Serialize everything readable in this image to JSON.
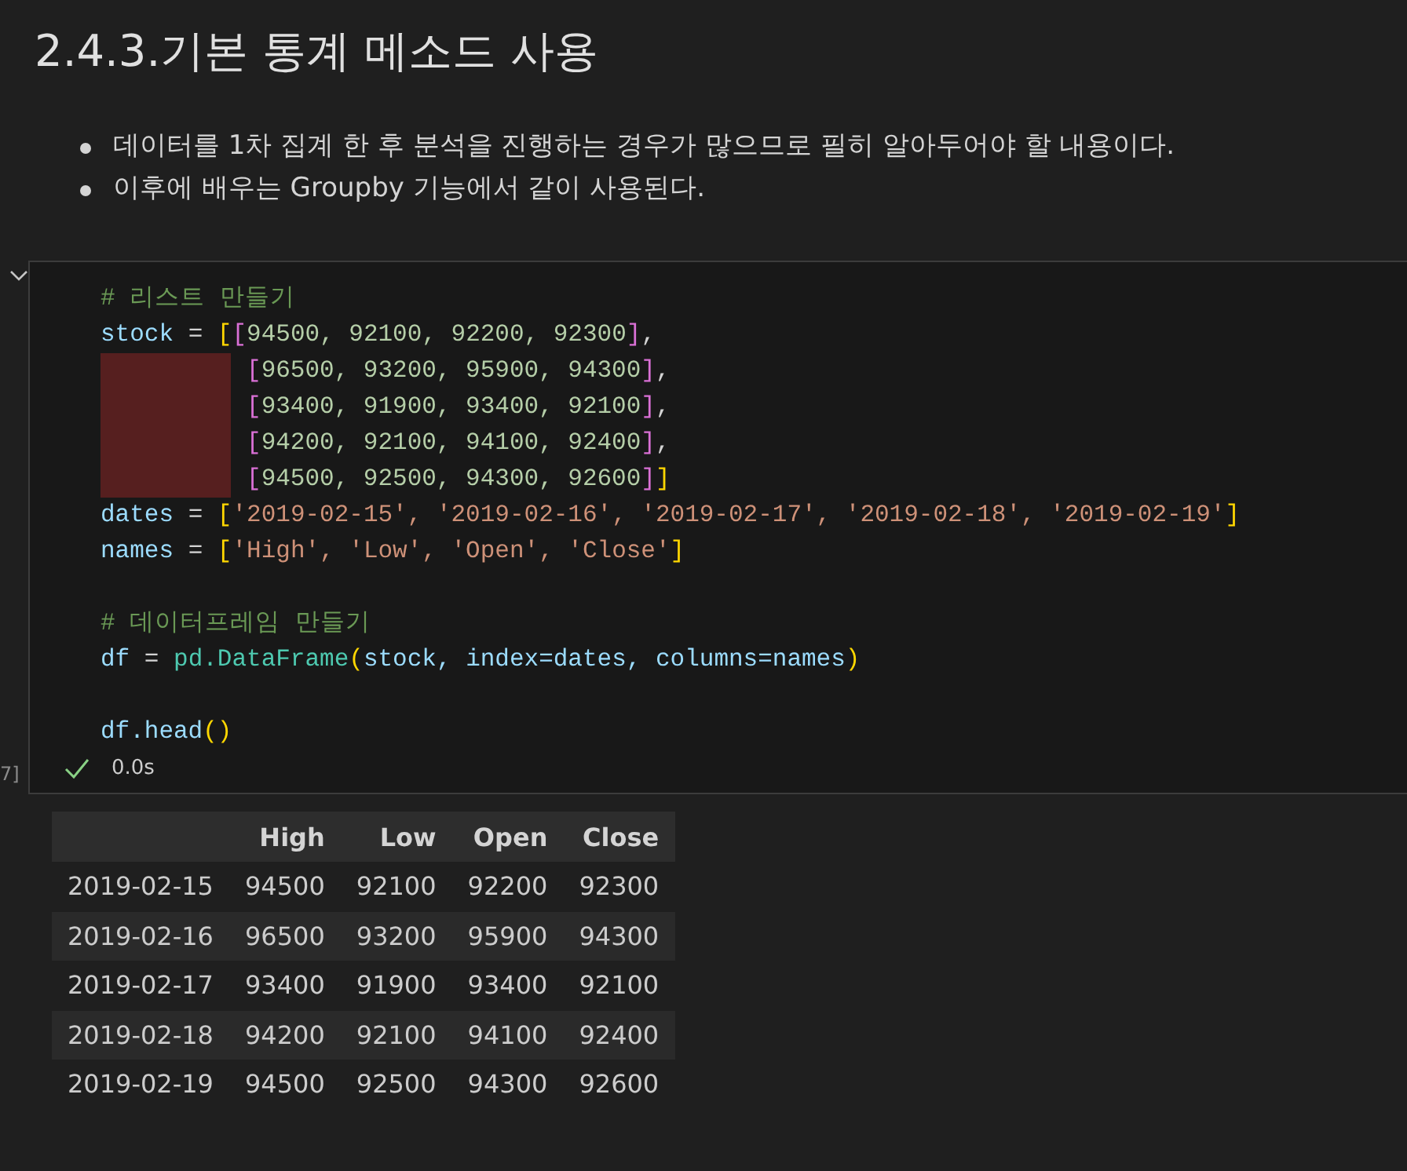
{
  "heading": "2.4.3.기본 통계 메소드 사용",
  "bullets": [
    "데이터를 1차 집계 한 후 분석을 진행하는 경우가 많으므로 필히 알아두어야 할 내용이다.",
    "이후에 배우는 Groupby 기능에서 같이 사용된다."
  ],
  "cell": {
    "expanded": true,
    "execution_count": "7]",
    "status": "0.0s",
    "code": [
      {
        "kind": "code",
        "tokens": [
          {
            "text": "# 리스트 만들기",
            "kind": "comment"
          }
        ]
      },
      {
        "kind": "code",
        "tokens": [
          {
            "text": "stock",
            "kind": "var"
          },
          {
            "text": " = ",
            "kind": "op"
          },
          {
            "text": "[",
            "kind": "b1"
          },
          {
            "text": "[",
            "kind": "b2"
          },
          {
            "text": "94500, 92100, 92200, 92300",
            "kind": "num"
          },
          {
            "text": "]",
            "kind": "b2"
          },
          {
            "text": ",",
            "kind": "op"
          }
        ]
      },
      {
        "kind": "code",
        "bad_indent": true,
        "tokens": [
          {
            "text": "[",
            "kind": "b2"
          },
          {
            "text": "96500, 93200, 95900, 94300",
            "kind": "num"
          },
          {
            "text": "]",
            "kind": "b2"
          },
          {
            "text": ",",
            "kind": "op"
          }
        ]
      },
      {
        "kind": "code",
        "bad_indent": true,
        "tokens": [
          {
            "text": "[",
            "kind": "b2"
          },
          {
            "text": "93400, 91900, 93400, 92100",
            "kind": "num"
          },
          {
            "text": "]",
            "kind": "b2"
          },
          {
            "text": ",",
            "kind": "op"
          }
        ]
      },
      {
        "kind": "code",
        "bad_indent": true,
        "tokens": [
          {
            "text": "[",
            "kind": "b2"
          },
          {
            "text": "94200, 92100, 94100, 92400",
            "kind": "num"
          },
          {
            "text": "]",
            "kind": "b2"
          },
          {
            "text": ",",
            "kind": "op"
          }
        ]
      },
      {
        "kind": "code",
        "bad_indent": true,
        "tokens": [
          {
            "text": "[",
            "kind": "b2"
          },
          {
            "text": "94500, 92500, 94300, 92600",
            "kind": "num"
          },
          {
            "text": "]",
            "kind": "b2"
          },
          {
            "text": "]",
            "kind": "b1"
          }
        ]
      },
      {
        "kind": "code",
        "tokens": [
          {
            "text": "dates",
            "kind": "var"
          },
          {
            "text": " = ",
            "kind": "op"
          },
          {
            "text": "[",
            "kind": "b1"
          },
          {
            "text": "'2019-02-15', '2019-02-16', '2019-02-17', '2019-02-18', '2019-02-19'",
            "kind": "str"
          },
          {
            "text": "]",
            "kind": "b1"
          }
        ]
      },
      {
        "kind": "code",
        "tokens": [
          {
            "text": "names",
            "kind": "var"
          },
          {
            "text": " = ",
            "kind": "op"
          },
          {
            "text": "[",
            "kind": "b1"
          },
          {
            "text": "'High', 'Low', 'Open', 'Close'",
            "kind": "str"
          },
          {
            "text": "]",
            "kind": "b1"
          }
        ]
      },
      {
        "kind": "blank"
      },
      {
        "kind": "code",
        "tokens": [
          {
            "text": "# 데이터프레임 만들기",
            "kind": "comment"
          }
        ]
      },
      {
        "kind": "code",
        "tokens": [
          {
            "text": "df",
            "kind": "var"
          },
          {
            "text": " = ",
            "kind": "op"
          },
          {
            "text": "pd.DataFrame",
            "kind": "cls"
          },
          {
            "text": "(",
            "kind": "b1"
          },
          {
            "text": "stock, index=dates, columns=names",
            "kind": "var"
          },
          {
            "text": ")",
            "kind": "b1"
          }
        ]
      },
      {
        "kind": "blank"
      },
      {
        "kind": "code",
        "tokens": [
          {
            "text": "df.head",
            "kind": "var"
          },
          {
            "text": "()",
            "kind": "b1"
          }
        ]
      }
    ]
  },
  "table": {
    "columns": [
      "",
      "High",
      "Low",
      "Open",
      "Close"
    ],
    "rows": [
      [
        "2019-02-15",
        "94500",
        "92100",
        "92200",
        "92300"
      ],
      [
        "2019-02-16",
        "96500",
        "93200",
        "95900",
        "94300"
      ],
      [
        "2019-02-17",
        "93400",
        "91900",
        "93400",
        "92100"
      ],
      [
        "2019-02-18",
        "94200",
        "92100",
        "94100",
        "92400"
      ],
      [
        "2019-02-19",
        "94500",
        "92500",
        "94300",
        "92600"
      ]
    ]
  }
}
